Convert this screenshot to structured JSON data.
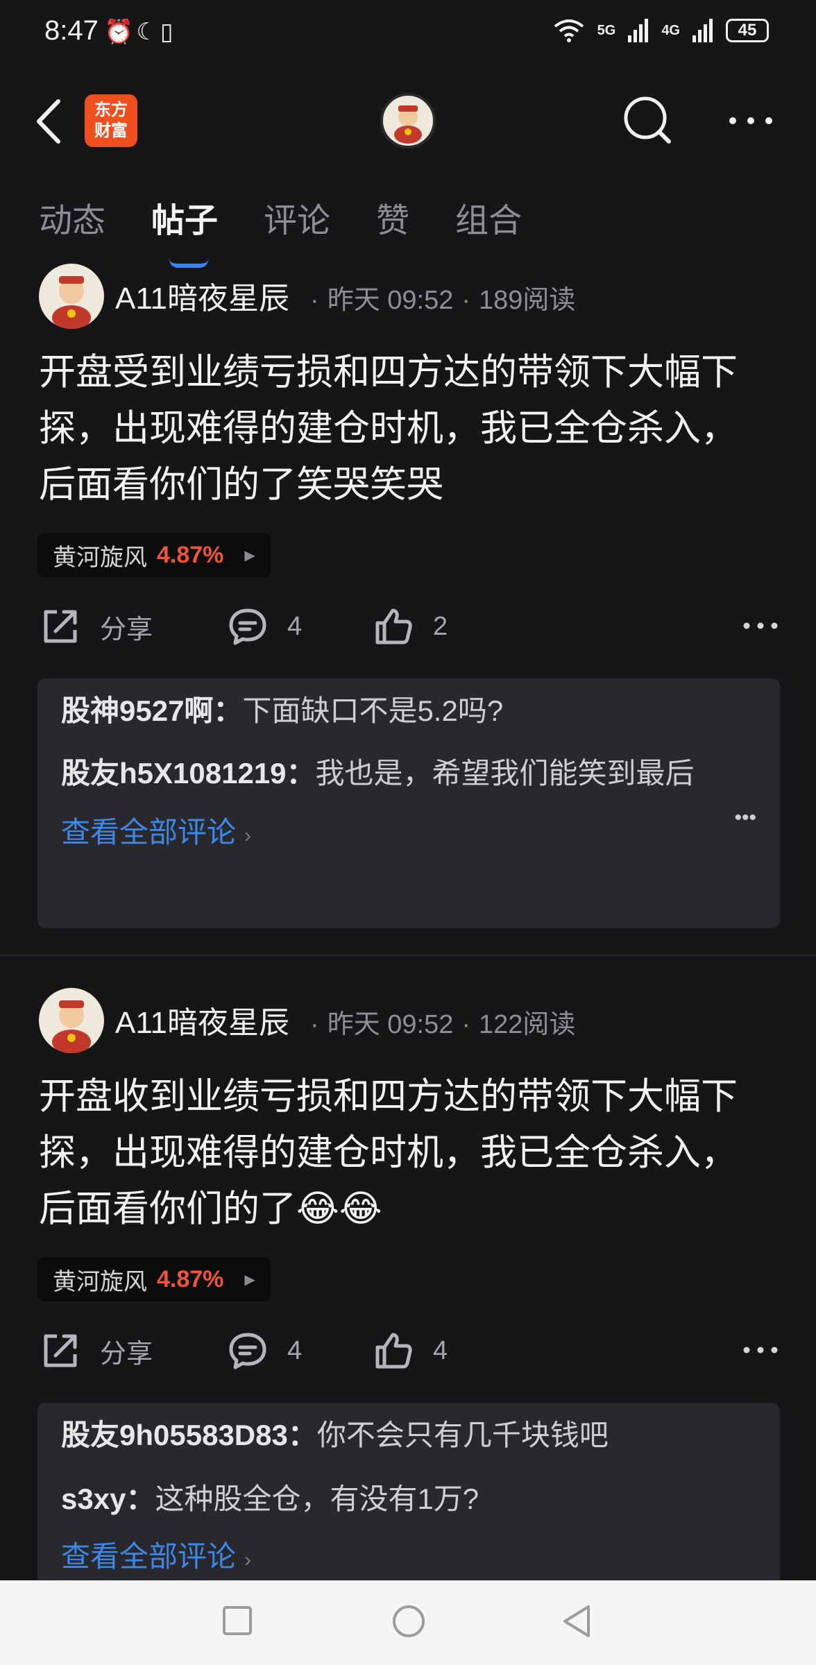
{
  "status": {
    "time": "8:47",
    "left_icons": [
      "alarm-icon",
      "moon-icon",
      "vibrate-icon"
    ],
    "net1": "5G",
    "net2": "4G",
    "battery": "45"
  },
  "header": {
    "logo_line1": "东方",
    "logo_line2": "财富"
  },
  "tabs": [
    {
      "label": "动态"
    },
    {
      "label": "帖子"
    },
    {
      "label": "评论"
    },
    {
      "label": "赞"
    },
    {
      "label": "组合"
    }
  ],
  "posts": [
    {
      "author": "A11暗夜星辰",
      "time": "昨天 09:52",
      "reads": "189阅读",
      "content": "开盘受到业绩亏损和四方达的带领下大幅下探，出现难得的建仓时机，我已全仓杀入，后面看你们的了笑哭笑哭",
      "stock_name": "黄河旋风",
      "stock_pct": "4.87%",
      "share_label": "分享",
      "comment_count": "4",
      "like_count": "2",
      "comments": [
        {
          "user": "股神9527啊：",
          "text": "下面缺口不是5.2吗?"
        },
        {
          "user": "股友h5X1081219：",
          "text": "我也是，希望我们能笑到最后"
        }
      ],
      "view_all": "查看全部评论"
    },
    {
      "author": "A11暗夜星辰",
      "time": "昨天 09:52",
      "reads": "122阅读",
      "content": "开盘收到业绩亏损和四方达的带领下大幅下探，出现难得的建仓时机，我已全仓杀入，后面看你们的了😂😂",
      "stock_name": "黄河旋风",
      "stock_pct": "4.87%",
      "share_label": "分享",
      "comment_count": "4",
      "like_count": "4",
      "comments": [
        {
          "user": "股友9h05583D83：",
          "text": "你不会只有几千块钱吧"
        },
        {
          "user": "s3xy：",
          "text": "这种股全仓，有没有1万?"
        }
      ],
      "view_all": "查看全部评论"
    }
  ],
  "colors": {
    "background": "#161618",
    "accent_blue": "#3d87e8",
    "up_red": "#f0543a",
    "brand_orange": "#ef4f1c"
  }
}
